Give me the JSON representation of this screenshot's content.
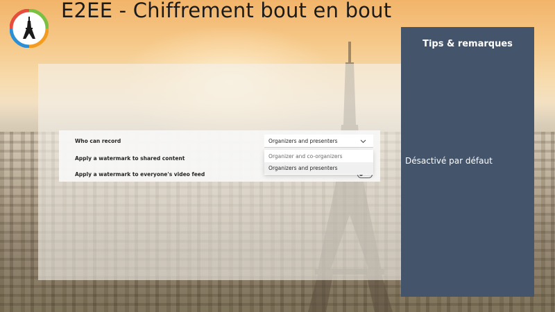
{
  "slide": {
    "title": "E2EE - Chiffrement bout en bout"
  },
  "settings": {
    "rows": [
      {
        "label": "Who can record"
      },
      {
        "label": "Apply a watermark to shared content"
      },
      {
        "label": "Apply a watermark to everyone's video feed"
      }
    ],
    "record_dropdown": {
      "selected": "Organizers and presenters",
      "options": [
        {
          "label": "Organizer and co-organizers"
        },
        {
          "label": "Organizers and presenters"
        }
      ]
    },
    "watermark_video_toggle_text": "Off"
  },
  "tips": {
    "heading": "Tips & remarques",
    "note": "Désactivé par défaut"
  },
  "colors": {
    "tips_background": "#44546a",
    "logo_ring_orange": "#f39c1f",
    "logo_ring_blue": "#2b8fd6",
    "logo_ring_green": "#7ac143"
  }
}
